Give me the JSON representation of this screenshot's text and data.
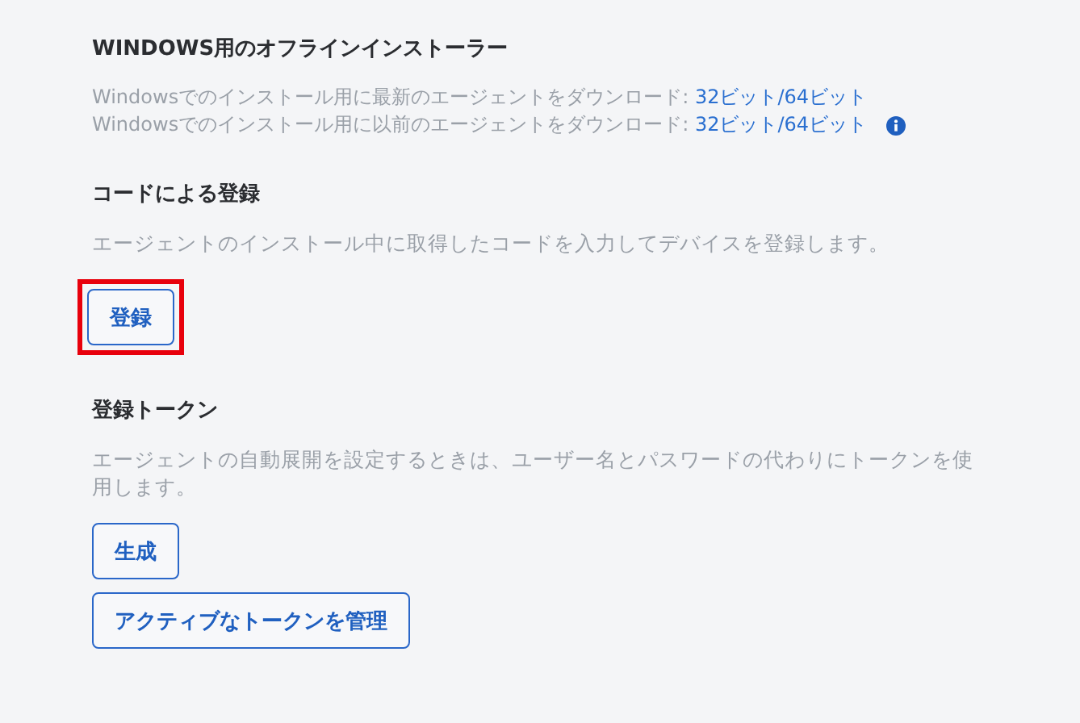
{
  "sections": [
    {
      "heading": "WINDOWS用のオフラインインストーラー",
      "lines": [
        {
          "text": "Windowsでのインストール用に最新のエージェントをダウンロード: ",
          "link": "32ビット/64ビット",
          "info": false
        },
        {
          "text": "Windowsでのインストール用に以前のエージェントをダウンロード: ",
          "link": "32ビット/64ビット",
          "info": true
        }
      ]
    },
    {
      "heading": "コードによる登録",
      "lines": [
        {
          "text": "エージェントのインストール中に取得したコードを入力してデバイスを登録します。"
        }
      ],
      "buttons": [
        {
          "label": "登録",
          "highlighted": true
        }
      ]
    },
    {
      "heading": "登録トークン",
      "lines": [
        {
          "text": "エージェントの自動展開を設定するときは、ユーザー名とパスワードの代わりにトークンを使用します。"
        }
      ],
      "buttons": [
        {
          "label": "生成",
          "highlighted": false
        },
        {
          "label": "アクティブなトークンを管理",
          "highlighted": false
        }
      ]
    }
  ]
}
